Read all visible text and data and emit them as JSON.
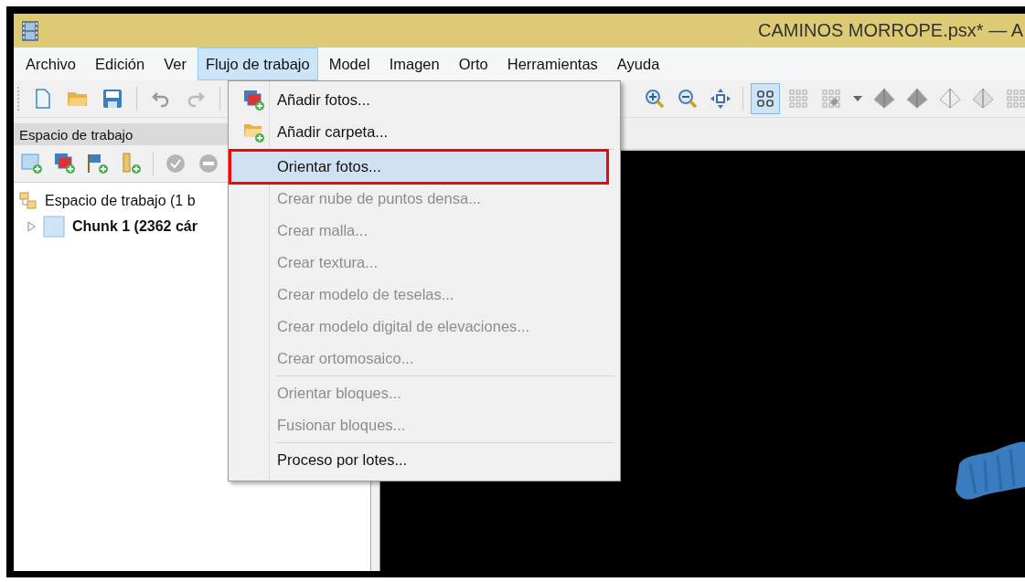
{
  "window": {
    "title": "CAMINOS MORROPE.psx* — A"
  },
  "menubar": [
    {
      "label": "Archivo",
      "selected": false
    },
    {
      "label": "Edición",
      "selected": false
    },
    {
      "label": "Ver",
      "selected": false
    },
    {
      "label": "Flujo de trabajo",
      "selected": true
    },
    {
      "label": "Model",
      "selected": false
    },
    {
      "label": "Imagen",
      "selected": false
    },
    {
      "label": "Orto",
      "selected": false
    },
    {
      "label": "Herramientas",
      "selected": false
    },
    {
      "label": "Ayuda",
      "selected": false
    }
  ],
  "toolbar_right": [
    {
      "kind": "zoom-in",
      "selected": false
    },
    {
      "kind": "zoom-out",
      "selected": false
    },
    {
      "kind": "move",
      "selected": false
    },
    {
      "kind": "grid",
      "selected": true
    },
    {
      "kind": "grid-faint",
      "selected": false
    },
    {
      "kind": "grid-tag",
      "selected": false
    },
    {
      "kind": "caret",
      "selected": false
    },
    {
      "kind": "pyramid",
      "selected": false
    },
    {
      "kind": "pyramid",
      "selected": false
    },
    {
      "kind": "pyramid-light",
      "selected": false
    },
    {
      "kind": "pyramid-faint",
      "selected": false
    },
    {
      "kind": "cut",
      "selected": false
    }
  ],
  "workspace": {
    "title": "Espacio de trabajo",
    "tree": [
      {
        "label": "Espacio de trabajo (1 b",
        "children": [
          {
            "label": "Chunk 1 (2362 cár",
            "expanded": false
          }
        ]
      }
    ]
  },
  "dropdown": {
    "groups": [
      [
        {
          "label": "Añadir fotos...",
          "kind": "photos",
          "disabled": false,
          "selected": false,
          "annotated": false
        },
        {
          "label": "Añadir carpeta...",
          "kind": "folder",
          "disabled": false,
          "selected": false,
          "annotated": false
        }
      ],
      [
        {
          "label": "Orientar fotos...",
          "disabled": false,
          "selected": true,
          "annotated": true
        },
        {
          "label": "Crear nube de puntos densa...",
          "disabled": true,
          "selected": false,
          "annotated": false
        },
        {
          "label": "Crear malla...",
          "disabled": true,
          "selected": false,
          "annotated": false
        },
        {
          "label": "Crear textura...",
          "disabled": true,
          "selected": false,
          "annotated": false
        },
        {
          "label": "Crear modelo de teselas...",
          "disabled": true,
          "selected": false,
          "annotated": false
        },
        {
          "label": "Crear modelo digital de elevaciones...",
          "disabled": true,
          "selected": false,
          "annotated": false
        },
        {
          "label": "Crear ortomosaico...",
          "disabled": true,
          "selected": false,
          "annotated": false
        }
      ],
      [
        {
          "label": "Orientar bloques...",
          "disabled": true,
          "selected": false,
          "annotated": false
        },
        {
          "label": "Fusionar bloques...",
          "disabled": true,
          "selected": false,
          "annotated": false
        }
      ],
      [
        {
          "label": "Proceso por lotes...",
          "disabled": false,
          "selected": false,
          "annotated": false
        }
      ]
    ]
  }
}
